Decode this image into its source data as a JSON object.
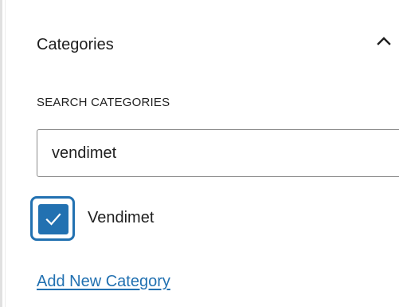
{
  "panel": {
    "title": "Categories",
    "toggle_icon": "chevron-up-icon",
    "expanded": true
  },
  "search": {
    "label": "SEARCH CATEGORIES",
    "value": "vendimet"
  },
  "categories": [
    {
      "label": "Vendimet",
      "checked": true,
      "focused": true
    }
  ],
  "actions": {
    "add_new_label": "Add New Category"
  },
  "colors": {
    "accent": "#2271b1",
    "text": "#1e1e1e",
    "border": "#8c8c8c"
  }
}
